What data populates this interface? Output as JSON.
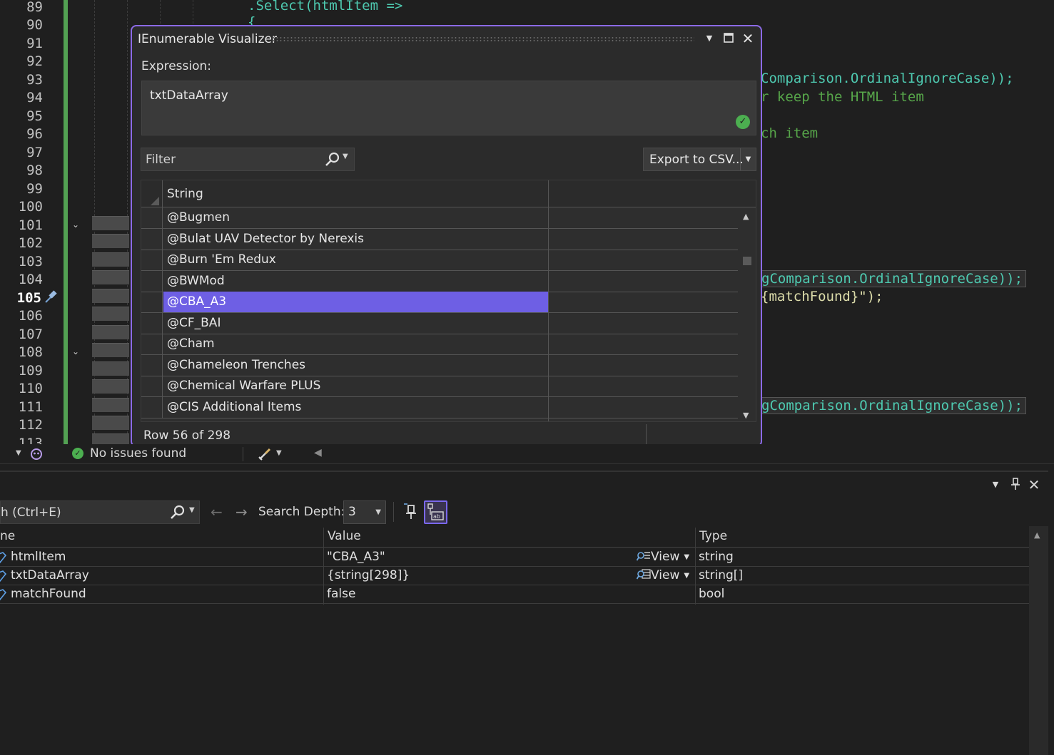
{
  "editor": {
    "line_numbers": [
      "89",
      "90",
      "91",
      "92",
      "93",
      "94",
      "95",
      "96",
      "97",
      "98",
      "99",
      "100",
      "101",
      "102",
      "103",
      "104",
      "105",
      "106",
      "107",
      "108",
      "109",
      "110",
      "111",
      "112",
      "113"
    ],
    "current_line": "105",
    "code": {
      "line89": ".Select(htmlItem =>",
      "line90": "{",
      "line93": "Comparison.OrdinalIgnoreCase));",
      "line94": "r keep the HTML item",
      "line96": "ch item",
      "line104": "gComparison.OrdinalIgnoreCase));",
      "line105": "{matchFound}\");",
      "line111": "gComparison.OrdinalIgnoreCase));"
    }
  },
  "visualizer": {
    "title": "IEnumerable Visualizer",
    "expression_label": "Expression:",
    "expression_value": "txtDataArray",
    "filter_placeholder": "Filter",
    "export_label": "Export to CSV...",
    "column_header": "String",
    "rows": [
      "@Bugmen",
      "@Bulat UAV Detector by Nerexis",
      "@Burn 'Em Redux",
      "@BWMod",
      "@CBA_A3",
      "@CF_BAI",
      "@Cham",
      "@Chameleon Trenches",
      "@Chemical Warfare PLUS",
      "@CIS Additional Items"
    ],
    "selected_row": "@CBA_A3",
    "status": "Row 56 of 298",
    "colors": {
      "accent": "#8c6ae6",
      "selection": "#6e5fe4"
    }
  },
  "status_strip": {
    "issues": "No issues found"
  },
  "locals": {
    "search_placeholder": "h (Ctrl+E)",
    "search_depth_label": "Search Depth:",
    "search_depth_value": "3",
    "columns": {
      "name": "ne",
      "value": "Value",
      "type": "Type"
    },
    "rows": [
      {
        "name": "htmlItem",
        "value": "\"CBA_A3\"",
        "view": "View",
        "type": "string"
      },
      {
        "name": "txtDataArray",
        "value": "{string[298]}",
        "view": "View",
        "type": "string[]"
      },
      {
        "name": "matchFound",
        "value": "false",
        "view": "",
        "type": "bool"
      }
    ]
  }
}
